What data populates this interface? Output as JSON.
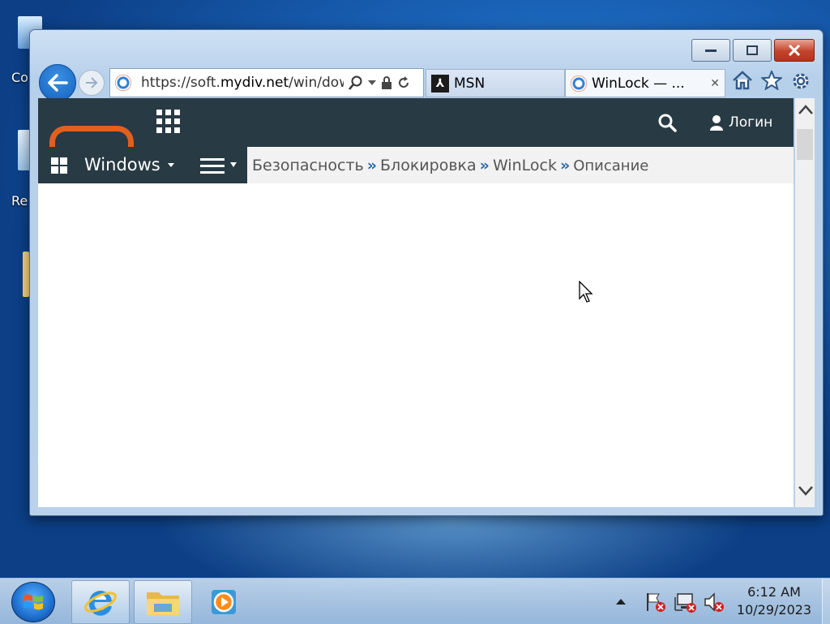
{
  "desktop": {
    "icons": [
      {
        "label": "Co"
      },
      {
        "label": "Re"
      }
    ]
  },
  "window": {
    "caption_buttons": {
      "minimize": "minimize",
      "maximize": "maximize",
      "close": "close"
    }
  },
  "browser": {
    "address": {
      "prefix": "https://soft.",
      "domain": "mydiv.net",
      "suffix": "/win/dow"
    },
    "tabs": [
      {
        "label": "MSN",
        "active": false
      },
      {
        "label": "WinLock — ...",
        "active": true,
        "close": "✕"
      }
    ]
  },
  "site": {
    "login_label": "Логин",
    "nav": {
      "platform": "Windows"
    },
    "breadcrumb": [
      {
        "label": "Безопасность"
      },
      {
        "label": "Блокировка"
      },
      {
        "label": "WinLock"
      },
      {
        "label": "Описание"
      }
    ],
    "breadcrumb_separator": "»",
    "colors": {
      "header_bg": "#283a44",
      "logo_accent": "#e0601f",
      "breadcrumb_link": "#2b6cb0"
    }
  },
  "taskbar": {
    "pinned": [
      {
        "name": "internet-explorer"
      },
      {
        "name": "file-explorer"
      },
      {
        "name": "media-player"
      }
    ],
    "clock": {
      "time": "6:12 AM",
      "date": "10/29/2023"
    }
  }
}
